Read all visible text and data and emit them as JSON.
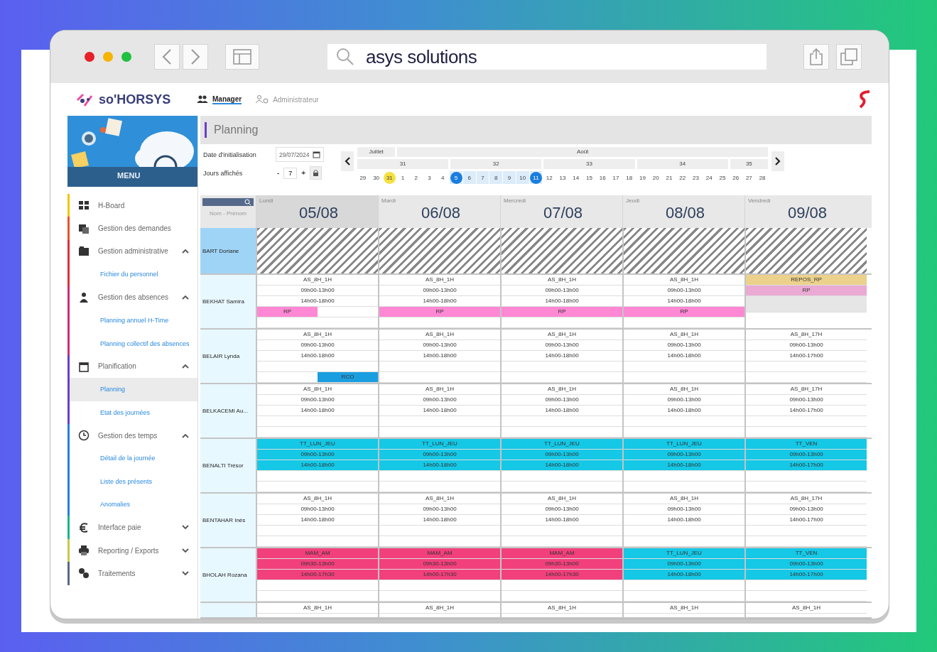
{
  "browser": {
    "address": "asys solutions"
  },
  "app": {
    "logo": "so'HORSYS",
    "tabs": [
      {
        "label": "Manager",
        "selected": true,
        "kind": "manager"
      },
      {
        "label": "Administrateur",
        "selected": false,
        "kind": "admin"
      }
    ]
  },
  "sidebar": {
    "banner": "MENU",
    "items": [
      {
        "label": "H-Board",
        "kind": "item",
        "color": "#f5c400"
      },
      {
        "label": "Gestion des demandes",
        "kind": "item",
        "color": "#e8552d"
      },
      {
        "label": "Gestion administrative",
        "kind": "group",
        "color": "#e0303a",
        "expanded": true
      },
      {
        "label": "Fichier du personnel",
        "kind": "sub",
        "selected": false,
        "color": "#e0303a"
      },
      {
        "label": "Gestion des absences",
        "kind": "group",
        "color": "#d42a78",
        "expanded": true
      },
      {
        "label": "Planning annuel H-Time",
        "kind": "sub",
        "selected": false,
        "color": "#d42a78"
      },
      {
        "label": "Planning collectif des absences",
        "kind": "sub",
        "selected": false,
        "color": "#d42a78"
      },
      {
        "label": "Planification",
        "kind": "group",
        "color": "#6a3fc8",
        "expanded": true
      },
      {
        "label": "Planning",
        "kind": "sub",
        "selected": true,
        "color": "#6a3fc8"
      },
      {
        "label": "Etat des journées",
        "kind": "sub",
        "selected": false,
        "color": "#6a3fc8"
      },
      {
        "label": "Gestion des temps",
        "kind": "group",
        "color": "#2a7de0",
        "expanded": true
      },
      {
        "label": "Détail de la journée",
        "kind": "sub",
        "selected": false,
        "color": "#2a7de0"
      },
      {
        "label": "Liste des présents",
        "kind": "sub",
        "selected": false,
        "color": "#2a7de0"
      },
      {
        "label": "Anomalies",
        "kind": "sub",
        "selected": false,
        "color": "#2a7de0"
      },
      {
        "label": "Interface paie",
        "kind": "group",
        "color": "#1fb58a",
        "expanded": false
      },
      {
        "label": "Reporting / Exports",
        "kind": "group",
        "color": "#c8c84a",
        "expanded": false
      },
      {
        "label": "Traitements",
        "kind": "group",
        "color": "#5a6a8a",
        "expanded": false
      }
    ]
  },
  "planning": {
    "title": "Planning",
    "init_date": {
      "label": "Date d'initialisation",
      "value": "29/07/2024"
    },
    "days_shown": {
      "label": "Jours affichés",
      "minus": "-",
      "value": "7",
      "plus": "+"
    },
    "months": [
      "Juillet",
      "Août"
    ],
    "weeks": [
      "31",
      "32",
      "33",
      "34",
      "35"
    ],
    "days": [
      {
        "label": "29",
        "today": false,
        "selected": false
      },
      {
        "label": "30",
        "today": false,
        "selected": false
      },
      {
        "label": "31",
        "today": true,
        "selected": false
      },
      {
        "label": "1",
        "today": false,
        "selected": false
      },
      {
        "label": "2",
        "today": false,
        "selected": false
      },
      {
        "label": "3",
        "today": false,
        "selected": false
      },
      {
        "label": "4",
        "today": false,
        "selected": false
      },
      {
        "label": "5",
        "today": false,
        "selected": true
      },
      {
        "label": "6",
        "today": false,
        "selected": true
      },
      {
        "label": "7",
        "today": false,
        "selected": true
      },
      {
        "label": "8",
        "today": false,
        "selected": true
      },
      {
        "label": "9",
        "today": false,
        "selected": true
      },
      {
        "label": "10",
        "today": false,
        "selected": true
      },
      {
        "label": "11",
        "today": false,
        "selected": true
      },
      {
        "label": "12",
        "today": false,
        "selected": false
      },
      {
        "label": "13",
        "today": false,
        "selected": false
      },
      {
        "label": "14",
        "today": false,
        "selected": false
      },
      {
        "label": "15",
        "today": false,
        "selected": false
      },
      {
        "label": "16",
        "today": false,
        "selected": false
      },
      {
        "label": "17",
        "today": false,
        "selected": false
      },
      {
        "label": "18",
        "today": false,
        "selected": false
      },
      {
        "label": "19",
        "today": false,
        "selected": false
      },
      {
        "label": "20",
        "today": false,
        "selected": false
      },
      {
        "label": "21",
        "today": false,
        "selected": false
      },
      {
        "label": "22",
        "today": false,
        "selected": false
      },
      {
        "label": "23",
        "today": false,
        "selected": false
      },
      {
        "label": "24",
        "today": false,
        "selected": false
      },
      {
        "label": "25",
        "today": false,
        "selected": false
      },
      {
        "label": "26",
        "today": false,
        "selected": false
      },
      {
        "label": "27",
        "today": false,
        "selected": false
      },
      {
        "label": "28",
        "today": false,
        "selected": false
      }
    ],
    "name_header": "Nom - Prénom",
    "columns": [
      {
        "weekday": "Lundi",
        "date": "05/08",
        "selected": true
      },
      {
        "weekday": "Mardi",
        "date": "06/08",
        "selected": false
      },
      {
        "weekday": "Mercredi",
        "date": "07/08",
        "selected": false
      },
      {
        "weekday": "Jeudi",
        "date": "08/08",
        "selected": false
      },
      {
        "weekday": "Vendredi",
        "date": "09/08",
        "selected": false
      }
    ],
    "rows": [
      {
        "name": "BART Doriane",
        "selected": true,
        "days": [
          {
            "kind": "hatched"
          },
          {
            "kind": "hatched"
          },
          {
            "kind": "hatched"
          },
          {
            "kind": "hatched"
          },
          {
            "kind": "hatched"
          }
        ]
      },
      {
        "name": "BEKHAT Samira",
        "selected": false,
        "days": [
          {
            "kind": "shift",
            "code": "AS_8H_1H",
            "times": [
              "09h00-13h00",
              "14h00-18h00"
            ],
            "bars": {
              "upper": {
                "morning": {
                  "label": "RP",
                  "color": "#ff88d4"
                }
              }
            }
          },
          {
            "kind": "shift",
            "code": "AS_8H_1H",
            "times": [
              "09h00-13h00",
              "14h00-18h00"
            ],
            "bars": {
              "upper": {
                "full": {
                  "label": "RP",
                  "color": "#ff88d4"
                }
              }
            }
          },
          {
            "kind": "shift",
            "code": "AS_8H_1H",
            "times": [
              "09h00-13h00",
              "14h00-18h00"
            ],
            "bars": {
              "upper": {
                "full": {
                  "label": "RP",
                  "color": "#ff88d4"
                }
              }
            }
          },
          {
            "kind": "shift",
            "code": "AS_8H_1H",
            "times": [
              "09h00-13h00",
              "14h00-18h00"
            ],
            "bars": {
              "upper": {
                "full": {
                  "label": "RP",
                  "color": "#ff88d4"
                }
              }
            }
          },
          {
            "kind": "shift",
            "code": "REPOS_RP",
            "color": "#ecd18c",
            "bars": {
              "upper": {
                "full": {
                  "label": "RP",
                  "color": "#eaaad4"
                }
              },
              "lower": {
                "full": {
                  "color": "#e6e6e6"
                }
              }
            }
          }
        ]
      },
      {
        "name": "BELAIR Lynda",
        "selected": false,
        "days": [
          {
            "kind": "shift",
            "code": "AS_8H_1H",
            "times": [
              "09h00-13h00",
              "14h00-18h00"
            ],
            "bars": {
              "lower": {
                "afternoon": {
                  "label": "RCO",
                  "color": "#1a9ee0"
                }
              }
            }
          },
          {
            "kind": "shift",
            "code": "AS_8H_1H",
            "times": [
              "09h00-13h00",
              "14h00-18h00"
            ]
          },
          {
            "kind": "shift",
            "code": "AS_8H_1H",
            "times": [
              "09h00-13h00",
              "14h00-18h00"
            ]
          },
          {
            "kind": "shift",
            "code": "AS_8H_1H",
            "times": [
              "09h00-13h00",
              "14h00-18h00"
            ]
          },
          {
            "kind": "shift",
            "code": "AS_8H_17H",
            "times": [
              "09h00-13h00",
              "14h00-17h00"
            ]
          }
        ]
      },
      {
        "name": "BELKACEMI Au...",
        "selected": false,
        "days": [
          {
            "kind": "shift",
            "code": "AS_8H_1H",
            "times": [
              "09h00-13h00",
              "14h00-18h00"
            ]
          },
          {
            "kind": "shift",
            "code": "AS_8H_1H",
            "times": [
              "09h00-13h00",
              "14h00-18h00"
            ]
          },
          {
            "kind": "shift",
            "code": "AS_8H_1H",
            "times": [
              "09h00-13h00",
              "14h00-18h00"
            ]
          },
          {
            "kind": "shift",
            "code": "AS_8H_1H",
            "times": [
              "09h00-13h00",
              "14h00-18h00"
            ]
          },
          {
            "kind": "shift",
            "code": "AS_8H_17H",
            "times": [
              "09h00-13h00",
              "14h00-17h00"
            ]
          }
        ]
      },
      {
        "name": "BENALTI Trésor",
        "selected": false,
        "days": [
          {
            "kind": "shift",
            "code": "TT_LUN_JEU",
            "color": "#14c8e6",
            "times": [
              "09h00-13h00",
              "14h00-18h00"
            ]
          },
          {
            "kind": "shift",
            "code": "TT_LUN_JEU",
            "color": "#14c8e6",
            "times": [
              "09h00-13h00",
              "14h00-18h00"
            ]
          },
          {
            "kind": "shift",
            "code": "TT_LUN_JEU",
            "color": "#14c8e6",
            "times": [
              "09h00-13h00",
              "14h00-18h00"
            ]
          },
          {
            "kind": "shift",
            "code": "TT_LUN_JEU",
            "color": "#14c8e6",
            "times": [
              "09h00-13h00",
              "14h00-18h00"
            ]
          },
          {
            "kind": "shift",
            "code": "TT_VEN",
            "color": "#14c8e6",
            "times": [
              "09h00-13h00",
              "14h00-17h00"
            ]
          }
        ]
      },
      {
        "name": "BENTAHAR Inès",
        "selected": false,
        "days": [
          {
            "kind": "shift",
            "code": "AS_8H_1H",
            "times": [
              "09h00-13h00",
              "14h00-18h00"
            ]
          },
          {
            "kind": "shift",
            "code": "AS_8H_1H",
            "times": [
              "09h00-13h00",
              "14h00-18h00"
            ]
          },
          {
            "kind": "shift",
            "code": "AS_8H_1H",
            "times": [
              "09h00-13h00",
              "14h00-18h00"
            ]
          },
          {
            "kind": "shift",
            "code": "AS_8H_1H",
            "times": [
              "09h00-13h00",
              "14h00-18h00"
            ]
          },
          {
            "kind": "shift",
            "code": "AS_8H_17H",
            "times": [
              "09h00-13h00",
              "14h00-17h00"
            ]
          }
        ]
      },
      {
        "name": "BHOLAH Rozana",
        "selected": false,
        "days": [
          {
            "kind": "shift",
            "code": "MAM_AM",
            "color": "#f2407c",
            "times": [
              "09h30-13h00",
              "14h00-17h30"
            ]
          },
          {
            "kind": "shift",
            "code": "MAM_AM",
            "color": "#f2407c",
            "times": [
              "09h30-13h00",
              "14h00-17h30"
            ]
          },
          {
            "kind": "shift",
            "code": "MAM_AM",
            "color": "#f2407c",
            "times": [
              "09h30-13h00",
              "14h00-17h30"
            ]
          },
          {
            "kind": "shift",
            "code": "TT_LUN_JEU",
            "color": "#14c8e6",
            "times": [
              "09h00-13h00",
              "14h00-18h00"
            ]
          },
          {
            "kind": "shift",
            "code": "TT_VEN",
            "color": "#14c8e6",
            "times": [
              "09h00-13h00",
              "14h00-17h00"
            ]
          }
        ]
      },
      {
        "selected": false,
        "days": [
          {
            "kind": "shift",
            "code": "AS_8H_1H"
          },
          {
            "kind": "shift",
            "code": "AS_8H_1H"
          },
          {
            "kind": "shift",
            "code": "AS_8H_1H"
          },
          {
            "kind": "shift",
            "code": "AS_8H_1H"
          },
          {
            "kind": "shift",
            "code": "AS_8H_1H"
          }
        ]
      }
    ]
  }
}
